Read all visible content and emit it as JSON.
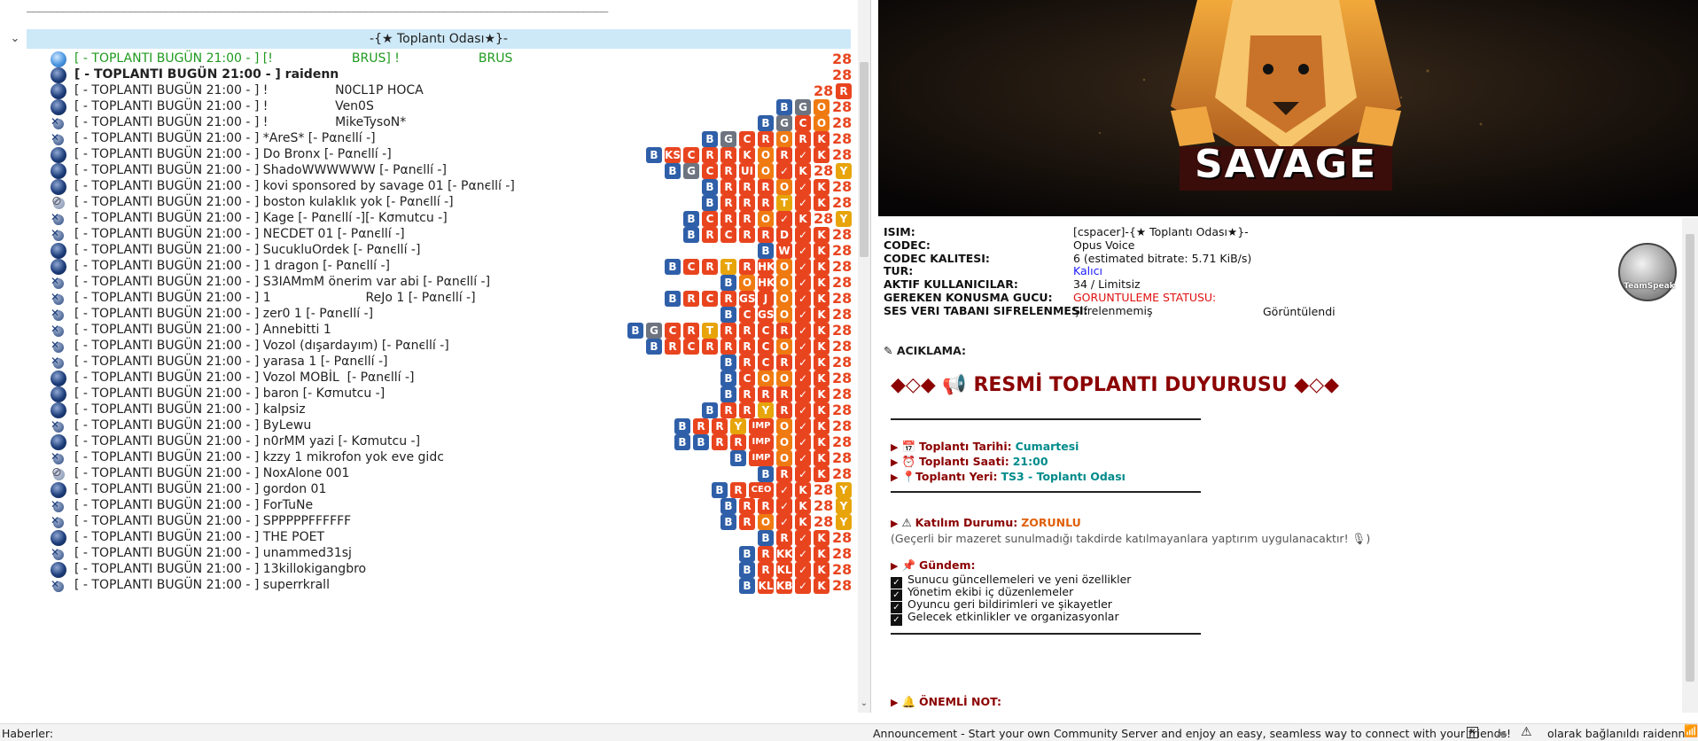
{
  "tree": {
    "top_separator": "________________________________________________________________________________________________",
    "channel_name": "-{★ Toplantı Odası★}-",
    "users": [
      {
        "icon": "talk",
        "name": "[ - TOPLANTI BUGÜN 21:00 - ] [!                    BRUS] !                    BRUS",
        "style": "g",
        "badges": [
          "28"
        ]
      },
      {
        "icon": "on",
        "name": "[ - TOPLANTI BUGÜN 21:00 - ] raidenn",
        "style": "b",
        "badges": [
          "28"
        ]
      },
      {
        "icon": "on",
        "name": "[ - TOPLANTI BUGÜN 21:00 - ] !                 N0CL1P HOCA",
        "style": "",
        "badges": [
          "28",
          "R"
        ]
      },
      {
        "icon": "on",
        "name": "[ - TOPLANTI BUGÜN 21:00 - ] !                 Ven0S",
        "style": "",
        "badges": [
          "B",
          "G",
          "O",
          "28"
        ]
      },
      {
        "icon": "mute",
        "name": "[ - TOPLANTI BUGÜN 21:00 - ] !                 MikeTysoN*",
        "style": "",
        "badges": [
          "B",
          "G",
          "C",
          "O",
          "28"
        ]
      },
      {
        "icon": "mute",
        "name": "[ - TOPLANTI BUGÜN 21:00 - ] *AreS* [- Pαnєllí -]",
        "style": "",
        "badges": [
          "B",
          "G",
          "C",
          "R",
          "O",
          "R",
          "K",
          "28"
        ]
      },
      {
        "icon": "on",
        "name": "[ - TOPLANTI BUGÜN 21:00 - ] Do Bronx [- Pαnєllí -]",
        "style": "",
        "badges": [
          "B",
          "KS",
          "C",
          "R",
          "R",
          "K",
          "O",
          "R",
          "✓",
          "K",
          "28"
        ]
      },
      {
        "icon": "on",
        "name": "[ - TOPLANTI BUGÜN 21:00 - ] ShadoWWWWWW [- Pαnєllí -]",
        "style": "",
        "badges": [
          "B",
          "G",
          "C",
          "R",
          "UI",
          "O",
          "✓",
          "K",
          "28",
          "Y"
        ]
      },
      {
        "icon": "on",
        "name": "[ - TOPLANTI BUGÜN 21:00 - ] kovi sponsored by savage 01 [- Pαnєllí -]",
        "style": "",
        "badges": [
          "B",
          "R",
          "R",
          "R",
          "O",
          "✓",
          "K",
          "28"
        ]
      },
      {
        "icon": "away",
        "name": "[ - TOPLANTI BUGÜN 21:00 - ] boston kulaklık yok [- Pαnєllí -]",
        "style": "",
        "badges": [
          "B",
          "R",
          "R",
          "R",
          "T",
          "✓",
          "K",
          "28"
        ]
      },
      {
        "icon": "mute",
        "name": "[ - TOPLANTI BUGÜN 21:00 - ] Kage [- Pαnєllí -][- Kσmutcu -]",
        "style": "",
        "badges": [
          "B",
          "C",
          "R",
          "R",
          "O",
          "✓",
          "K",
          "28",
          "Y"
        ]
      },
      {
        "icon": "mute",
        "name": "[ - TOPLANTI BUGÜN 21:00 - ] NECDET 01 [- Pαnєllí -]",
        "style": "",
        "badges": [
          "B",
          "R",
          "C",
          "R",
          "R",
          "D",
          "✓",
          "K",
          "28"
        ]
      },
      {
        "icon": "on",
        "name": "[ - TOPLANTI BUGÜN 21:00 - ] SucukluOrdek [- Pαnєllí -]",
        "style": "",
        "badges": [
          "B",
          "W",
          "✓",
          "K",
          "28"
        ]
      },
      {
        "icon": "on",
        "name": "[ - TOPLANTI BUGÜN 21:00 - ] 1 dragon [- Pαnєllí -]",
        "style": "",
        "badges": [
          "B",
          "C",
          "R",
          "T",
          "R",
          "HK",
          "O",
          "✓",
          "K",
          "28"
        ]
      },
      {
        "icon": "mute",
        "name": "[ - TOPLANTI BUGÜN 21:00 - ] S3IAMmM önerim var abi [- Pαnєllí -]",
        "style": "",
        "badges": [
          "B",
          "O",
          "HK",
          "O",
          "✓",
          "K",
          "28"
        ]
      },
      {
        "icon": "mute",
        "name": "[ - TOPLANTI BUGÜN 21:00 - ] 1                        ReJo 1 [- Pαnєllí -]",
        "style": "",
        "badges": [
          "B",
          "R",
          "C",
          "R",
          "GS",
          "J",
          "O",
          "✓",
          "K",
          "28"
        ]
      },
      {
        "icon": "mute",
        "name": "[ - TOPLANTI BUGÜN 21:00 - ] zer0 1 [- Pαnєllí -]",
        "style": "",
        "badges": [
          "B",
          "C",
          "GS",
          "O",
          "✓",
          "K",
          "28"
        ]
      },
      {
        "icon": "mute",
        "name": "[ - TOPLANTI BUGÜN 21:00 - ] Annebitti 1",
        "style": "",
        "badges": [
          "B",
          "G",
          "C",
          "R",
          "T",
          "R",
          "R",
          "C",
          "R",
          "✓",
          "K",
          "28"
        ]
      },
      {
        "icon": "mute",
        "name": "[ - TOPLANTI BUGÜN 21:00 - ] Vozol (dışardayım) [- Pαnєllí -]",
        "style": "",
        "badges": [
          "B",
          "R",
          "C",
          "R",
          "R",
          "R",
          "C",
          "O",
          "✓",
          "K",
          "28"
        ]
      },
      {
        "icon": "mute",
        "name": "[ - TOPLANTI BUGÜN 21:00 - ] yarasa 1 [- Pαnєllí -]",
        "style": "",
        "badges": [
          "B",
          "R",
          "C",
          "R",
          "✓",
          "K",
          "28"
        ]
      },
      {
        "icon": "on",
        "name": "[ - TOPLANTI BUGÜN 21:00 - ] Vozol MOBİL  [- Pαnєllí -]",
        "style": "",
        "badges": [
          "B",
          "C",
          "O",
          "O",
          "✓",
          "K",
          "28"
        ]
      },
      {
        "icon": "on",
        "name": "[ - TOPLANTI BUGÜN 21:00 - ] baron [- Kσmutcu -]",
        "style": "",
        "badges": [
          "B",
          "R",
          "R",
          "R",
          "✓",
          "K",
          "28"
        ]
      },
      {
        "icon": "on",
        "name": "[ - TOPLANTI BUGÜN 21:00 - ] kalpsiz",
        "style": "",
        "badges": [
          "B",
          "R",
          "R",
          "Y",
          "R",
          "✓",
          "K",
          "28"
        ]
      },
      {
        "icon": "mute",
        "name": "[ - TOPLANTI BUGÜN 21:00 - ] ByLewu",
        "style": "",
        "badges": [
          "B",
          "R",
          "R",
          "Y",
          "IMP",
          "O",
          "✓",
          "K",
          "28"
        ]
      },
      {
        "icon": "on",
        "name": "[ - TOPLANTI BUGÜN 21:00 - ] n0rMM yazi [- Kσmutcu -]",
        "style": "",
        "badges": [
          "B",
          "B",
          "R",
          "R",
          "IMP",
          "O",
          "✓",
          "K",
          "28"
        ]
      },
      {
        "icon": "mute",
        "name": "[ - TOPLANTI BUGÜN 21:00 - ] kzzy 1 mikrofon yok eve gidc",
        "style": "",
        "badges": [
          "B",
          "IMP",
          "O",
          "✓",
          "K",
          "28"
        ]
      },
      {
        "icon": "away",
        "name": "[ - TOPLANTI BUGÜN 21:00 - ] NoxAlone 001",
        "style": "",
        "badges": [
          "B",
          "R",
          "✓",
          "K",
          "28"
        ]
      },
      {
        "icon": "on",
        "name": "[ - TOPLANTI BUGÜN 21:00 - ] gordon 01",
        "style": "",
        "badges": [
          "B",
          "R",
          "CEO",
          "✓",
          "K",
          "28",
          "Y"
        ]
      },
      {
        "icon": "mute",
        "name": "[ - TOPLANTI BUGÜN 21:00 - ] ForTuNe",
        "style": "",
        "badges": [
          "B",
          "R",
          "R",
          "✓",
          "K",
          "28",
          "Y"
        ]
      },
      {
        "icon": "mute",
        "name": "[ - TOPLANTI BUGÜN 21:00 - ] SPPPPPFFFFFF",
        "style": "",
        "badges": [
          "B",
          "R",
          "O",
          "✓",
          "K",
          "28",
          "Y"
        ]
      },
      {
        "icon": "on",
        "name": "[ - TOPLANTI BUGÜN 21:00 - ] THE POET",
        "style": "",
        "badges": [
          "B",
          "R",
          "✓",
          "K",
          "28"
        ]
      },
      {
        "icon": "mute",
        "name": "[ - TOPLANTI BUGÜN 21:00 - ] unammed31sj",
        "style": "",
        "badges": [
          "B",
          "R",
          "KK",
          "✓",
          "K",
          "28"
        ]
      },
      {
        "icon": "on",
        "name": "[ - TOPLANTI BUGÜN 21:00 - ] 13killokigangbro",
        "style": "",
        "badges": [
          "B",
          "R",
          "KL",
          "✓",
          "K",
          "28"
        ]
      },
      {
        "icon": "mute",
        "name": "[ - TOPLANTI BUGÜN 21:00 - ] superrkrall",
        "style": "",
        "badges": [
          "B",
          "KL",
          "KB",
          "✓",
          "K",
          "28"
        ]
      }
    ]
  },
  "banner": {
    "text": "SAVAGE"
  },
  "info": {
    "rows": [
      {
        "k": "ISIM:",
        "v": "[cspacer]-{★ Toplantı Odası★}-"
      },
      {
        "k": "CODEC:",
        "v": "Opus Voice"
      },
      {
        "k": "CODEC KALITESI:",
        "v": "6 (estimated bitrate: 5.71 KiB/s)"
      },
      {
        "k": "TUR:",
        "v": "Kalıcı"
      },
      {
        "k": "AKTIF KULLANICILAR:",
        "v": "34 / Limitsiz"
      },
      {
        "k": "GEREKEN KONUSMA GUCU:",
        "v": "GORUNTULEME STATUSU:"
      },
      {
        "k": "SES VERI TABANI SIFRELENMESI:",
        "v": "Şifrelenmemiş"
      }
    ],
    "view_status_value": "Görüntülendi",
    "desc_label": "ACIKLAMA:",
    "title": "◆◇◆ 📢 RESMİ TOPLANTI DUYURUSU ◆◇◆",
    "date_label": "Toplantı Tarihi:",
    "date_value": "Cumartesi",
    "time_label": "Toplantı Saati:",
    "time_value": "21:00",
    "place_label": "Toplantı Yeri:",
    "place_value": "TS3 - Toplantı Odası",
    "attend_label": "Katılım Durumu:",
    "attend_value": "ZORUNLU",
    "attend_note": "(Geçerli bir mazeret sunulmadığı takdirde katılmayanlara yaptırım uygulanacaktır! 🎙)",
    "agenda_label": "Gündem:",
    "agenda": [
      "Sunucu güncellemeleri ve yeni özellikler",
      "Yönetim ekibi iç düzenlemeler",
      "Oyuncu geri bildirimleri ve şikayetler",
      "Gelecek etkinlikler ve organizasyonlar"
    ],
    "note_label": "ÖNEMLİ NOT:",
    "logo_text": "TeamSpeak"
  },
  "status": {
    "news": "Haberler:",
    "announcement": "Announcement - Start your own Community Server and enjoy an easy, seamless way to connect with your friends!",
    "connection": "olarak bağlanıldı raidenn"
  }
}
